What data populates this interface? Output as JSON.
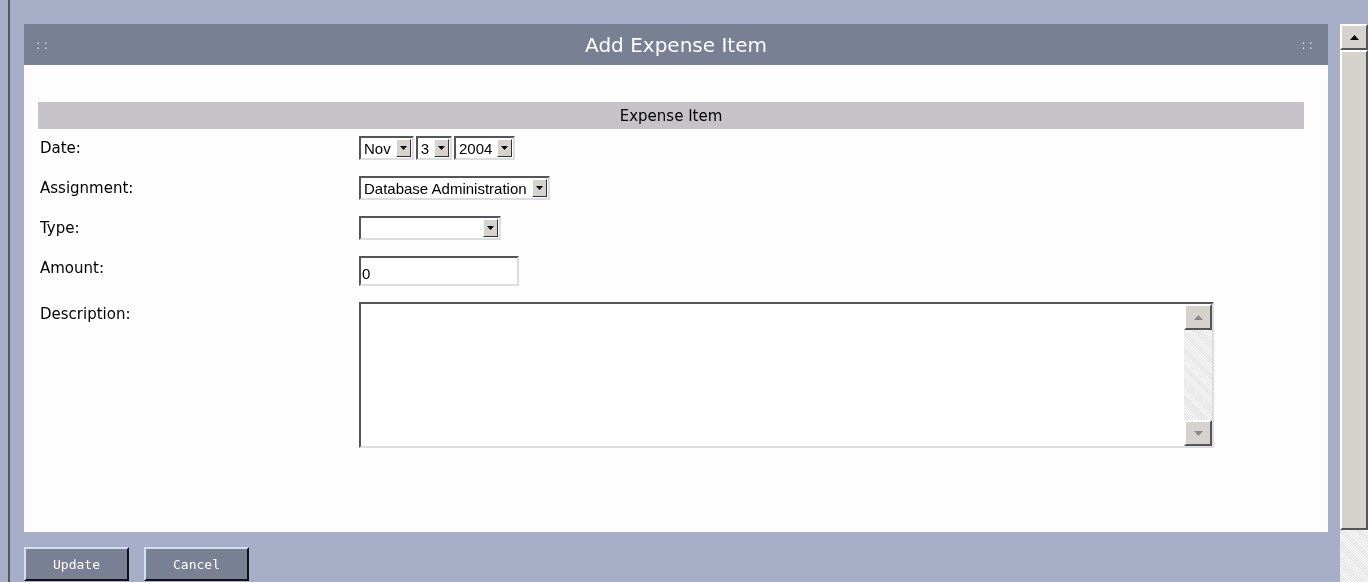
{
  "dialog": {
    "title": "Add Expense Item",
    "grip_left": "::",
    "grip_right": "::"
  },
  "section": {
    "title": "Expense Item"
  },
  "fields": [
    {
      "kind": "date",
      "label": "Date:",
      "parts": [
        {
          "value": "Nov"
        },
        {
          "value": "3"
        },
        {
          "value": "2004"
        }
      ]
    },
    {
      "kind": "select",
      "label": "Assignment:",
      "value": "Database Administration"
    },
    {
      "kind": "select",
      "label": "Type:"
    },
    {
      "kind": "text",
      "label": "Amount:",
      "value": "0"
    },
    {
      "kind": "textarea",
      "label": "Description:"
    }
  ],
  "buttons": [
    "Update",
    "Cancel"
  ]
}
